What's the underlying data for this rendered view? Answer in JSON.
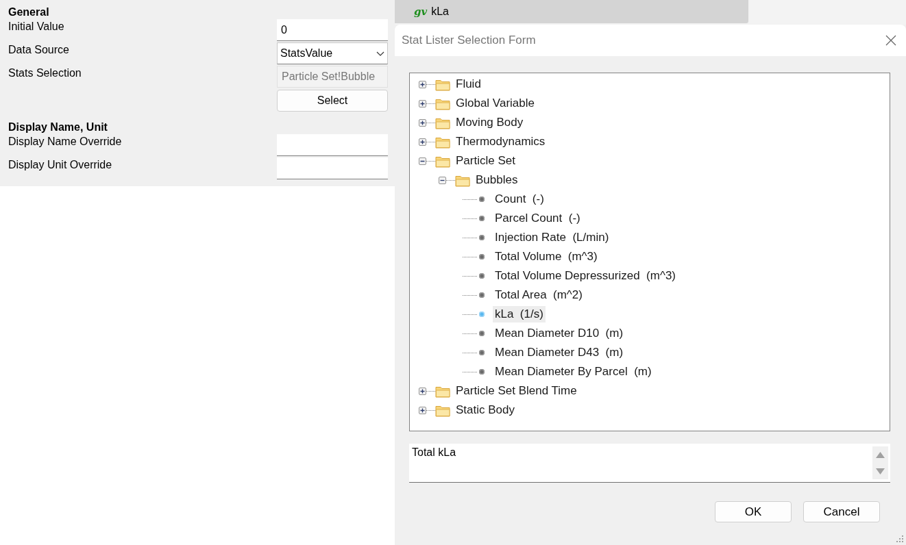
{
  "properties": {
    "sections": [
      {
        "title": "General",
        "rows": [
          {
            "kind": "text",
            "label": "Initial Value",
            "value": "0"
          },
          {
            "kind": "dropdown",
            "label": "Data Source",
            "value": "StatsValue"
          },
          {
            "kind": "readonly",
            "label": "Stats Selection",
            "value": "Particle Set!Bubble"
          },
          {
            "kind": "button",
            "text": "Select"
          }
        ]
      },
      {
        "title": "Display Name, Unit",
        "rows": [
          {
            "kind": "text",
            "label": "Display Name Override"
          },
          {
            "kind": "text",
            "label": "Display Unit Override"
          }
        ]
      }
    ]
  },
  "document_tab": {
    "badge": "gv",
    "title": "kLa"
  },
  "dialog": {
    "title": "Stat Lister Selection Form",
    "tree": [
      {
        "kind": "folder",
        "label": "Fluid",
        "expanded": false,
        "selected": false
      },
      {
        "kind": "folder",
        "label": "Global Variable",
        "expanded": false,
        "selected": false
      },
      {
        "kind": "folder",
        "label": "Moving Body",
        "expanded": false,
        "selected": false
      },
      {
        "kind": "folder",
        "label": "Thermodynamics",
        "expanded": false,
        "selected": false
      },
      {
        "kind": "folder",
        "label": "Particle Set",
        "expanded": true,
        "selected": false,
        "children": [
          {
            "kind": "folder",
            "label": "Bubbles",
            "expanded": true,
            "selected": false,
            "children": [
              {
                "kind": "stat",
                "label": "Count  (-)",
                "selected": false
              },
              {
                "kind": "stat",
                "label": "Parcel Count  (-)",
                "selected": false
              },
              {
                "kind": "stat",
                "label": "Injection Rate  (L/min)",
                "selected": false
              },
              {
                "kind": "stat",
                "label": "Total Volume  (m^3)",
                "selected": false
              },
              {
                "kind": "stat",
                "label": "Total Volume Depressurized  (m^3)",
                "selected": false
              },
              {
                "kind": "stat",
                "label": "Total Area  (m^2)",
                "selected": false
              },
              {
                "kind": "stat",
                "label": "kLa  (1/s)",
                "selected": true
              },
              {
                "kind": "stat",
                "label": "Mean Diameter D10  (m)",
                "selected": false
              },
              {
                "kind": "stat",
                "label": "Mean Diameter D43  (m)",
                "selected": false
              },
              {
                "kind": "stat",
                "label": "Mean Diameter By Parcel  (m)",
                "selected": false
              }
            ]
          }
        ]
      },
      {
        "kind": "folder",
        "label": "Particle Set Blend Time",
        "expanded": false,
        "selected": false
      },
      {
        "kind": "folder",
        "label": "Static Body",
        "expanded": false,
        "selected": false
      }
    ],
    "description": "Total kLa",
    "buttons": [
      "OK",
      "Cancel"
    ]
  }
}
